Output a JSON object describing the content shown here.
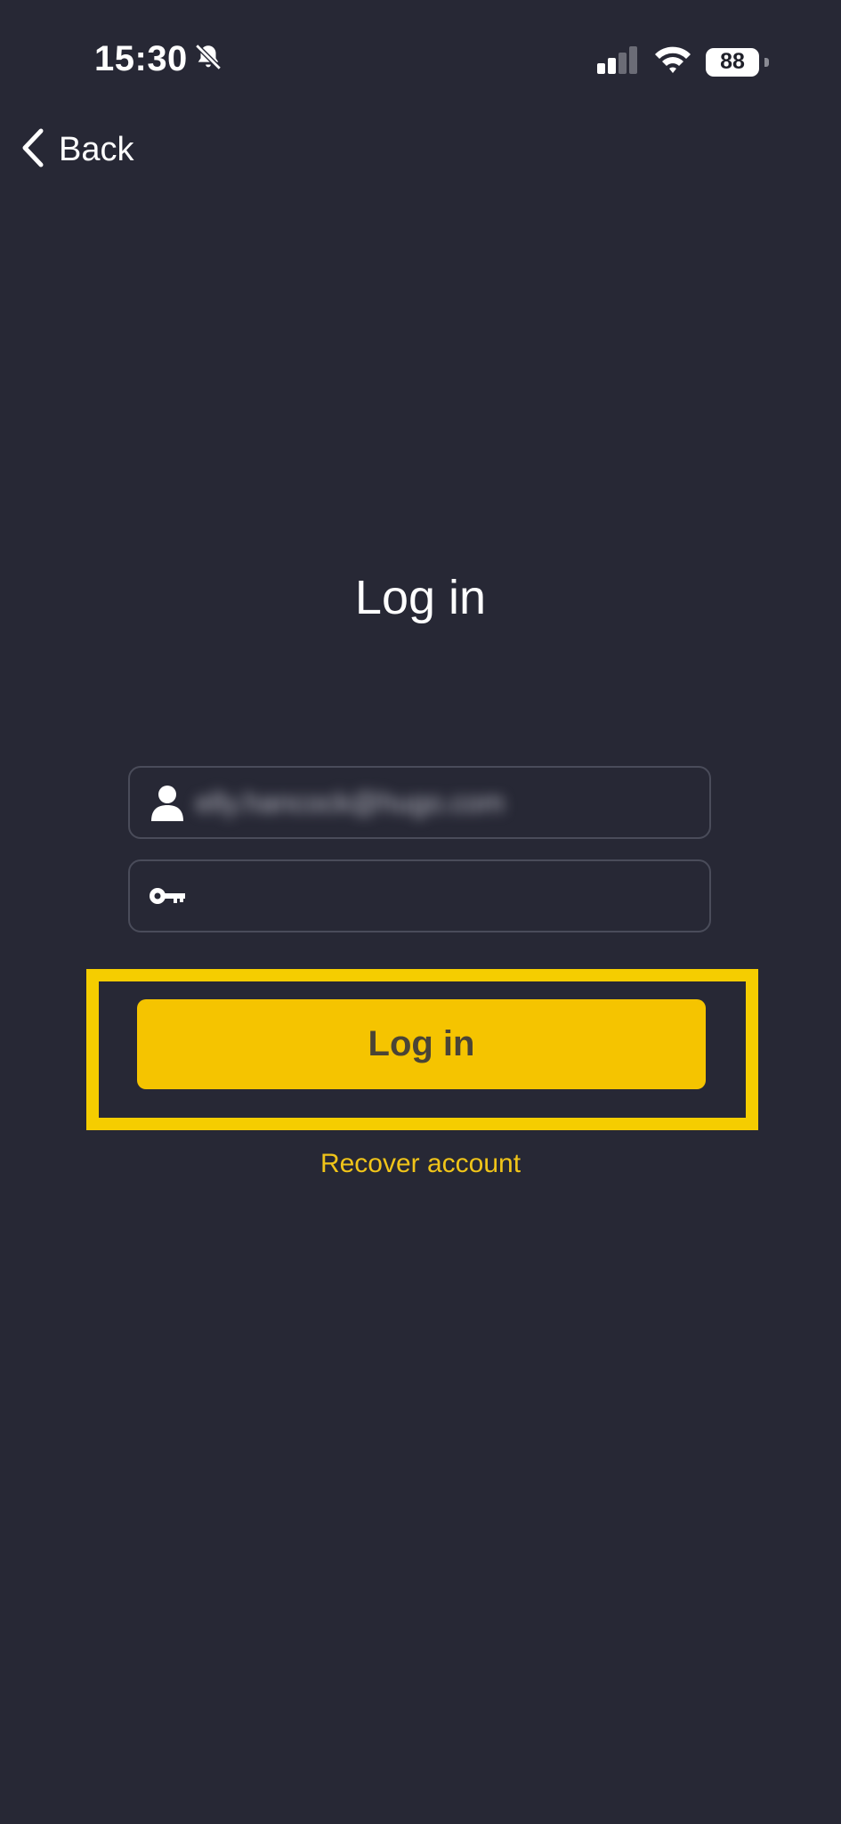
{
  "status_bar": {
    "time": "15:30",
    "battery_level": "88",
    "signal_bars_active": 2,
    "signal_bars_total": 4
  },
  "nav": {
    "back_label": "Back"
  },
  "page": {
    "title": "Log in"
  },
  "form": {
    "username_value": "elly.hancock@hugo.com",
    "password_value": ""
  },
  "actions": {
    "login_label": "Log in",
    "recover_label": "Recover account"
  },
  "colors": {
    "background": "#272835",
    "accent": "#f5c400",
    "highlight": "#f5cd00",
    "link": "#f0c419"
  },
  "icons": {
    "muted": "bell-slash-icon",
    "signal": "cellular-signal-icon",
    "wifi": "wifi-icon",
    "battery": "battery-icon",
    "back": "chevron-left-icon",
    "user": "user-icon",
    "password": "key-icon"
  }
}
